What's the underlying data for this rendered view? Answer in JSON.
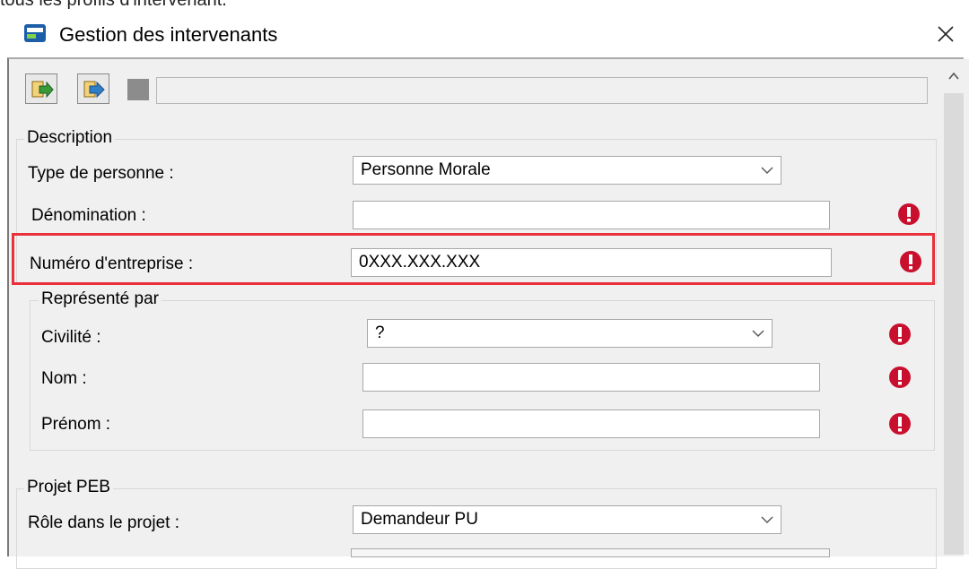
{
  "top_text": "tous les profils d'intervenant.",
  "window": {
    "title": "Gestion des intervenants",
    "close_symbol": "✕"
  },
  "toolbar": {
    "buttons": [
      {
        "icon": "import-icon"
      },
      {
        "icon": "export-icon"
      },
      {
        "icon": "disabled-icon"
      }
    ],
    "path_value": ""
  },
  "description": {
    "legend": "Description",
    "type_personne": {
      "label": "Type de personne :",
      "value": "Personne Morale"
    },
    "denomination": {
      "label": "Dénomination :",
      "value": ""
    },
    "numero_entreprise": {
      "label": "Numéro d'entreprise :",
      "value": "0XXX.XXX.XXX"
    }
  },
  "represente_par": {
    "legend": "Représenté par",
    "civilite": {
      "label": "Civilité :",
      "value": "?"
    },
    "nom": {
      "label": "Nom :",
      "value": ""
    },
    "prenom": {
      "label": "Prénom :",
      "value": ""
    }
  },
  "projet_peb": {
    "legend": "Projet PEB",
    "role": {
      "label": "Rôle dans le projet :",
      "value": "Demandeur PU"
    }
  },
  "colors": {
    "error_icon": "#c8102e",
    "highlight_border": "#e8313a",
    "app_icon": "#1c5fa8"
  }
}
